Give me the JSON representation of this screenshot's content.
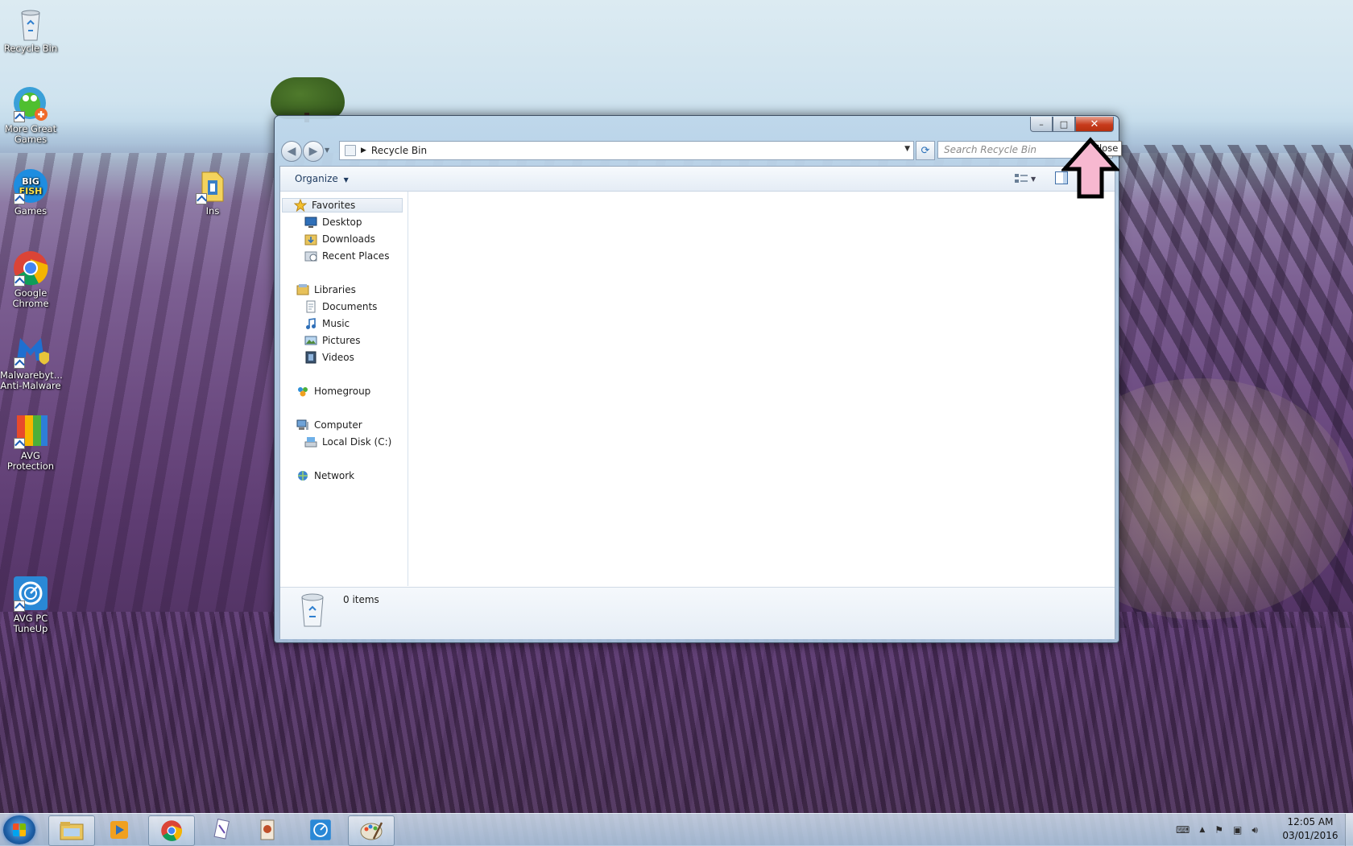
{
  "desktop": {
    "icons": [
      {
        "label": "Recycle Bin",
        "icon": "recycle-bin-icon"
      },
      {
        "label": "More Great Games",
        "icon": "more-great-games-icon"
      },
      {
        "label": "Games",
        "icon": "big-fish-games-icon"
      },
      {
        "label": "Ins",
        "icon": "folder-icon"
      },
      {
        "label": "Google Chrome",
        "icon": "chrome-icon"
      },
      {
        "label": "Malwarebyt... Anti-Malware",
        "icon": "malwarebytes-icon"
      },
      {
        "label": "AVG Protection",
        "icon": "avg-protection-icon"
      },
      {
        "label": "AVG PC TuneUp",
        "icon": "avg-tuneup-icon"
      }
    ]
  },
  "window": {
    "caption_buttons": {
      "minimize": "–",
      "maximize": "□",
      "close": "✕"
    },
    "address": {
      "crumb": "Recycle Bin"
    },
    "search": {
      "placeholder": "Search Recycle Bin"
    },
    "toolbar": {
      "organize": "Organize"
    },
    "nav": {
      "favorites": "Favorites",
      "favorites_items": [
        "Desktop",
        "Downloads",
        "Recent Places"
      ],
      "libraries": "Libraries",
      "libraries_items": [
        "Documents",
        "Music",
        "Pictures",
        "Videos"
      ],
      "homegroup": "Homegroup",
      "computer": "Computer",
      "computer_items": [
        "Local Disk (C:)"
      ],
      "network": "Network"
    },
    "details": {
      "item_count": "0 items"
    }
  },
  "tooltip": {
    "text": "Close"
  },
  "annotation": {
    "color": "#f7b8d0",
    "outline": "#000000"
  },
  "taskbar": {
    "buttons": [
      "windows-explorer",
      "media-player",
      "google-chrome",
      "app-card",
      "app-document",
      "avg-tuneup",
      "paint"
    ],
    "clock": {
      "time": "12:05 AM",
      "date": "03/01/2016"
    }
  }
}
